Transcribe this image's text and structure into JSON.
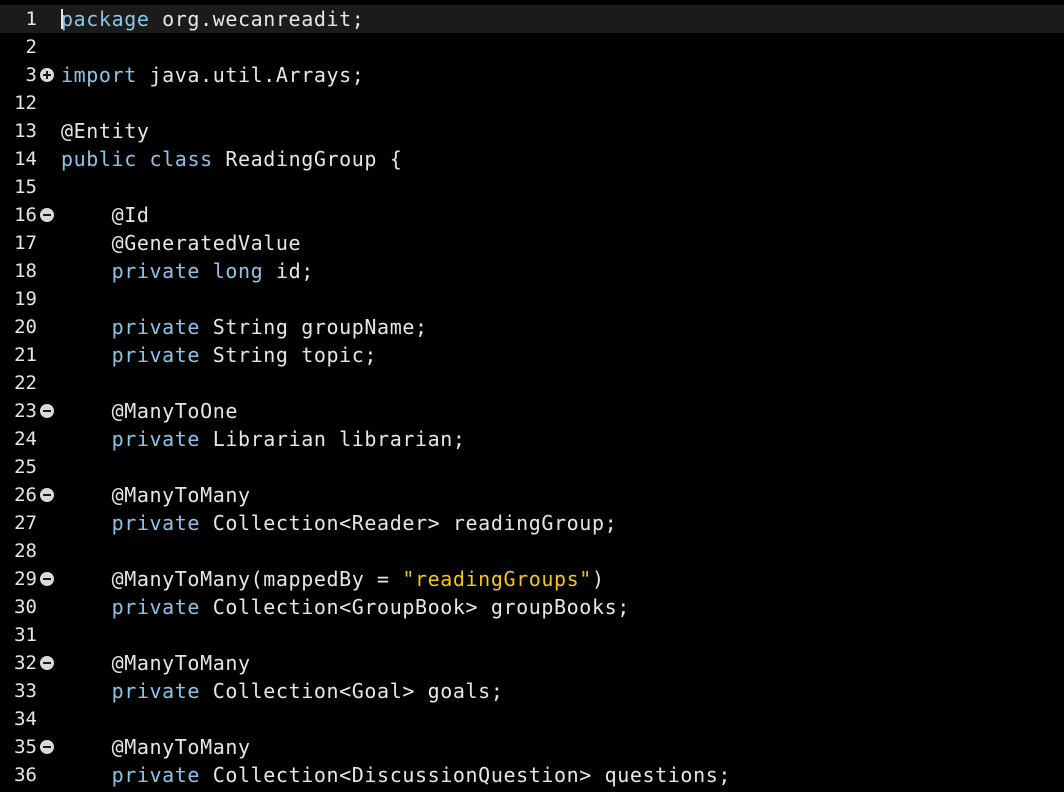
{
  "editor": {
    "lines": [
      {
        "num": "1",
        "fold": "",
        "indent": "",
        "tokens": [
          [
            "kw",
            "package"
          ],
          [
            "plain",
            " org.wecanreadit;"
          ]
        ]
      },
      {
        "num": "2",
        "fold": "",
        "indent": "",
        "tokens": []
      },
      {
        "num": "3",
        "fold": "plus",
        "indent": "",
        "tokens": [
          [
            "kw",
            "import"
          ],
          [
            "plain",
            " java.util.Arrays;"
          ]
        ]
      },
      {
        "num": "12",
        "fold": "",
        "indent": "",
        "tokens": []
      },
      {
        "num": "13",
        "fold": "",
        "indent": "",
        "tokens": [
          [
            "plain",
            "@Entity"
          ]
        ]
      },
      {
        "num": "14",
        "fold": "",
        "indent": "",
        "tokens": [
          [
            "kw",
            "public"
          ],
          [
            "plain",
            " "
          ],
          [
            "kw",
            "class"
          ],
          [
            "plain",
            " ReadingGroup {"
          ]
        ]
      },
      {
        "num": "15",
        "fold": "",
        "indent": "",
        "tokens": []
      },
      {
        "num": "16",
        "fold": "minus",
        "indent": "    ",
        "tokens": [
          [
            "plain",
            "@Id"
          ]
        ]
      },
      {
        "num": "17",
        "fold": "",
        "indent": "    ",
        "tokens": [
          [
            "plain",
            "@GeneratedValue"
          ]
        ]
      },
      {
        "num": "18",
        "fold": "",
        "indent": "    ",
        "tokens": [
          [
            "kw",
            "private"
          ],
          [
            "plain",
            " "
          ],
          [
            "kw",
            "long"
          ],
          [
            "plain",
            " id;"
          ]
        ]
      },
      {
        "num": "19",
        "fold": "",
        "indent": "",
        "tokens": []
      },
      {
        "num": "20",
        "fold": "",
        "indent": "    ",
        "tokens": [
          [
            "kw",
            "private"
          ],
          [
            "plain",
            " String groupName;"
          ]
        ]
      },
      {
        "num": "21",
        "fold": "",
        "indent": "    ",
        "tokens": [
          [
            "kw",
            "private"
          ],
          [
            "plain",
            " String topic;"
          ]
        ]
      },
      {
        "num": "22",
        "fold": "",
        "indent": "",
        "tokens": []
      },
      {
        "num": "23",
        "fold": "minus",
        "indent": "    ",
        "tokens": [
          [
            "plain",
            "@ManyToOne"
          ]
        ]
      },
      {
        "num": "24",
        "fold": "",
        "indent": "    ",
        "tokens": [
          [
            "kw",
            "private"
          ],
          [
            "plain",
            " Librarian librarian;"
          ]
        ]
      },
      {
        "num": "25",
        "fold": "",
        "indent": "",
        "tokens": []
      },
      {
        "num": "26",
        "fold": "minus",
        "indent": "    ",
        "tokens": [
          [
            "plain",
            "@ManyToMany"
          ]
        ]
      },
      {
        "num": "27",
        "fold": "",
        "indent": "    ",
        "tokens": [
          [
            "kw",
            "private"
          ],
          [
            "plain",
            " Collection<Reader> readingGroup;"
          ]
        ]
      },
      {
        "num": "28",
        "fold": "",
        "indent": "",
        "tokens": []
      },
      {
        "num": "29",
        "fold": "minus",
        "indent": "    ",
        "tokens": [
          [
            "plain",
            "@ManyToMany(mappedBy = "
          ],
          [
            "str",
            "\"readingGroups\""
          ],
          [
            "plain",
            ")"
          ]
        ]
      },
      {
        "num": "30",
        "fold": "",
        "indent": "    ",
        "tokens": [
          [
            "kw",
            "private"
          ],
          [
            "plain",
            " Collection<GroupBook> groupBooks;"
          ]
        ]
      },
      {
        "num": "31",
        "fold": "",
        "indent": "",
        "tokens": []
      },
      {
        "num": "32",
        "fold": "minus",
        "indent": "    ",
        "tokens": [
          [
            "plain",
            "@ManyToMany"
          ]
        ]
      },
      {
        "num": "33",
        "fold": "",
        "indent": "    ",
        "tokens": [
          [
            "kw",
            "private"
          ],
          [
            "plain",
            " Collection<Goal> goals;"
          ]
        ]
      },
      {
        "num": "34",
        "fold": "",
        "indent": "",
        "tokens": []
      },
      {
        "num": "35",
        "fold": "minus",
        "indent": "    ",
        "tokens": [
          [
            "plain",
            "@ManyToMany"
          ]
        ]
      },
      {
        "num": "36",
        "fold": "",
        "indent": "    ",
        "tokens": [
          [
            "kw",
            "private"
          ],
          [
            "plain",
            " Collection<DiscussionQuestion> questions;"
          ]
        ]
      }
    ],
    "current_line": "1",
    "colors": {
      "background": "#000000",
      "keyword": "#8cc4e8",
      "string": "#f5c518",
      "text": "#e6e6e6",
      "current_line_highlight": "#1b1b1b"
    }
  }
}
